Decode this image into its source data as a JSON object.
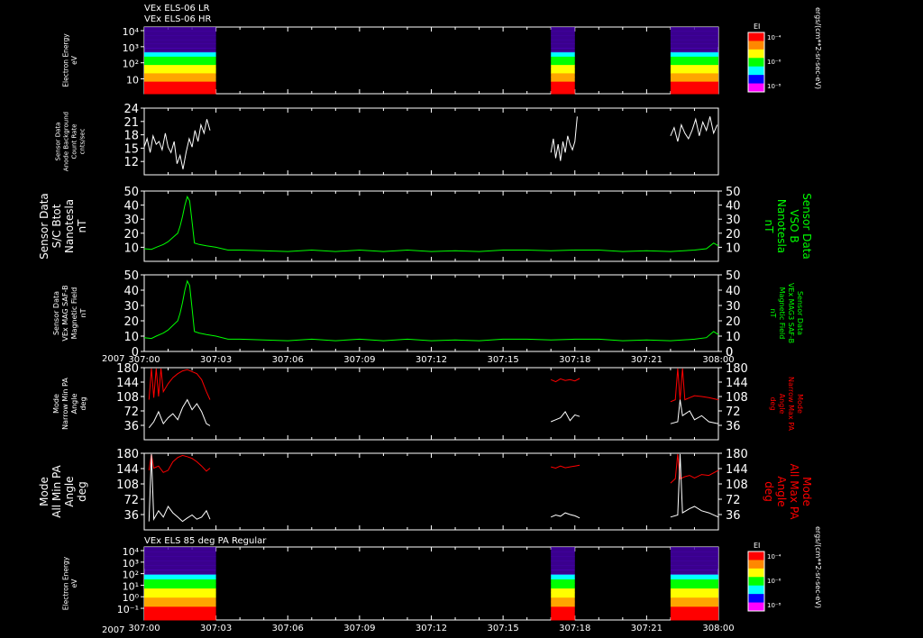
{
  "header": {
    "line1": "VEx ELS-06 LR",
    "line2": "VEx ELS-06 HR"
  },
  "panel7_title": "VEx ELS 85 deg PA Regular",
  "year": "2007",
  "x_ticks": [
    "307:00",
    "307:03",
    "307:06",
    "307:09",
    "307:12",
    "307:15",
    "307:18",
    "307:21",
    "308:00"
  ],
  "colors": {
    "white": "#ffffff",
    "green": "#00ff00",
    "red": "#ff0000",
    "frame": "#ffffff",
    "background": "#000000"
  },
  "colorbar": {
    "label": "EI",
    "units": "ergs/(cm**2-sr-sec-eV)",
    "ticks": [
      "10⁻⁴",
      "10⁻⁶",
      "10⁻⁸"
    ],
    "colors": [
      "#ff0000",
      "#ff8800",
      "#ffff00",
      "#00ff00",
      "#00ffff",
      "#0000ff",
      "#ff00ff"
    ]
  },
  "chart_data": [
    {
      "type": "heatmap",
      "ylabel": [
        "Electron Energy",
        "eV"
      ],
      "yscale": "log",
      "yticks": [
        "10⁴",
        "10³",
        "10²",
        "10"
      ],
      "data_blocks": [
        {
          "start": "307:00",
          "end": "307:03"
        },
        {
          "start": "307:17",
          "end": "307:18"
        },
        {
          "start": "307:22",
          "end": "307:24"
        }
      ]
    },
    {
      "type": "line",
      "ylabel": [
        "Sensor Data",
        "Anode Background",
        "Count Rate",
        "cnts/sec"
      ],
      "ylim": [
        12,
        24
      ],
      "yticks": [
        "24",
        "21",
        "18",
        "15",
        "12"
      ],
      "series": [
        {
          "color": "#ffffff",
          "segments": [
            {
              "x": [
                0.0,
                0.12,
                0.25,
                0.37,
                0.5,
                0.62,
                0.75,
                0.88,
                1.0,
                1.12,
                1.25,
                1.37,
                1.5,
                1.62,
                1.75,
                1.88,
                2.0,
                2.12,
                2.25,
                2.37,
                2.5,
                2.62,
                2.75
              ],
              "y": [
                17,
                18.5,
                16,
                19,
                17.5,
                18,
                16.5,
                19.5,
                17,
                16,
                18,
                14,
                15.5,
                13,
                16,
                18.5,
                17,
                20,
                18,
                21,
                19.5,
                22,
                20
              ]
            },
            {
              "x": [
                17.0,
                17.1,
                17.2,
                17.3,
                17.4,
                17.5,
                17.6,
                17.7,
                17.8,
                17.9,
                18.0,
                18.1
              ],
              "y": [
                16,
                18.5,
                15,
                17.5,
                14.5,
                18,
                16,
                19,
                17.5,
                16.5,
                18,
                22.5
              ]
            },
            {
              "x": [
                22.0,
                22.15,
                22.3,
                22.45,
                22.6,
                22.75,
                22.9,
                23.05,
                23.2,
                23.35,
                23.5,
                23.65,
                23.8,
                23.95
              ],
              "y": [
                19,
                20.5,
                18,
                21,
                19.5,
                18.5,
                20,
                22,
                19,
                21.5,
                20,
                22.5,
                19.5,
                21
              ]
            }
          ]
        }
      ]
    },
    {
      "type": "line",
      "ylabel": [
        "Sensor Data",
        "S/C Btot",
        "Nanotesla",
        "nT"
      ],
      "ylabel_right": [
        "Sensor Data",
        "VSO B",
        "Nanotesla",
        "nT"
      ],
      "ylim": [
        0,
        50
      ],
      "yticks": [
        "50",
        "40",
        "30",
        "20",
        "10"
      ],
      "series": [
        {
          "color": "#00ff00",
          "x": [
            0,
            0.3,
            0.5,
            0.8,
            1.0,
            1.2,
            1.4,
            1.5,
            1.6,
            1.7,
            1.8,
            1.9,
            2.0,
            2.1,
            2.3,
            2.6,
            3.0,
            3.5,
            4,
            5,
            6,
            7,
            8,
            9,
            10,
            11,
            12,
            13,
            14,
            15,
            16,
            17,
            18,
            19,
            20,
            21,
            22,
            23,
            23.5,
            23.8,
            24
          ],
          "y": [
            9,
            8.5,
            10,
            12,
            14,
            17,
            20,
            25,
            32,
            40,
            46,
            43,
            28,
            13,
            12,
            11,
            10,
            8,
            8,
            7.5,
            7,
            8,
            7,
            8,
            7,
            8,
            7,
            7.5,
            7,
            8,
            8,
            7.5,
            8,
            8,
            7,
            7.5,
            7,
            8,
            9,
            13,
            11
          ]
        }
      ]
    },
    {
      "type": "line",
      "ylabel": [
        "Sensor Data",
        "VEx MAG SAF-B",
        "Magnetic Field",
        "nT"
      ],
      "ylabel_right": [
        "Sensor Data",
        "VEx MAG3 SAF-B",
        "Magnetic Field",
        "nT"
      ],
      "ylim": [
        0,
        50
      ],
      "yticks": [
        "50",
        "40",
        "30",
        "20",
        "10",
        "0"
      ],
      "series": [
        {
          "color": "#00ff00",
          "x": [
            0,
            0.3,
            0.5,
            0.8,
            1.0,
            1.2,
            1.4,
            1.5,
            1.6,
            1.7,
            1.8,
            1.9,
            2.0,
            2.1,
            2.3,
            2.6,
            3.0,
            3.5,
            4,
            5,
            6,
            7,
            8,
            9,
            10,
            11,
            12,
            13,
            14,
            15,
            16,
            17,
            18,
            19,
            20,
            21,
            22,
            23,
            23.5,
            23.8,
            24
          ],
          "y": [
            9,
            8.5,
            10,
            12,
            14,
            17,
            20,
            25,
            32,
            40,
            46,
            43,
            28,
            13,
            12,
            11,
            10,
            8,
            8,
            7.5,
            7,
            8,
            7,
            8,
            7,
            8,
            7,
            7.5,
            7,
            8,
            8,
            7.5,
            8,
            8,
            7,
            7.5,
            7,
            8,
            9,
            13,
            11
          ]
        }
      ]
    },
    {
      "type": "line",
      "ylabel": [
        "Mode",
        "Narrow Min PA",
        "Angle",
        "deg"
      ],
      "ylabel_right": [
        "Mode",
        "Narrow Max PA",
        "Angle",
        "deg"
      ],
      "ylim": [
        0,
        180
      ],
      "yticks": [
        "180",
        "144",
        "108",
        "72",
        "36"
      ],
      "series": [
        {
          "color": "#ff0000",
          "segments": [
            {
              "x": [
                0.2,
                0.3,
                0.4,
                0.5,
                0.6,
                0.7,
                0.8,
                1.0,
                1.2,
                1.4,
                1.6,
                1.8,
                2.0,
                2.2,
                2.4,
                2.6,
                2.75
              ],
              "y": [
                100,
                178,
                105,
                178,
                108,
                178,
                120,
                140,
                155,
                165,
                172,
                175,
                170,
                165,
                150,
                120,
                100
              ]
            },
            {
              "x": [
                17.0,
                17.2,
                17.4,
                17.6,
                17.8,
                18.0,
                18.2
              ],
              "y": [
                150,
                145,
                152,
                148,
                150,
                147,
                153
              ]
            },
            {
              "x": [
                22.0,
                22.2,
                22.3,
                22.4,
                22.5,
                22.6,
                22.8,
                23.0,
                23.3,
                23.6,
                24.0
              ],
              "y": [
                95,
                100,
                178,
                100,
                178,
                100,
                105,
                110,
                108,
                105,
                100
              ]
            }
          ]
        },
        {
          "color": "#ffffff",
          "segments": [
            {
              "x": [
                0.2,
                0.4,
                0.6,
                0.8,
                1.0,
                1.2,
                1.4,
                1.6,
                1.8,
                2.0,
                2.2,
                2.4,
                2.6,
                2.75
              ],
              "y": [
                30,
                45,
                70,
                40,
                55,
                65,
                50,
                80,
                100,
                75,
                90,
                70,
                40,
                35
              ]
            },
            {
              "x": [
                17.0,
                17.2,
                17.4,
                17.6,
                17.8,
                18.0,
                18.2
              ],
              "y": [
                45,
                50,
                55,
                70,
                48,
                62,
                58
              ]
            },
            {
              "x": [
                22.0,
                22.3,
                22.4,
                22.5,
                22.8,
                23.0,
                23.3,
                23.6,
                24.0
              ],
              "y": [
                40,
                45,
                100,
                60,
                72,
                50,
                60,
                45,
                40
              ]
            }
          ]
        }
      ]
    },
    {
      "type": "line",
      "ylabel": [
        "Mode",
        "All Min PA",
        "Angle",
        "deg"
      ],
      "ylabel_right": [
        "Mode",
        "All Max PA",
        "Angle",
        "deg"
      ],
      "ylim": [
        0,
        180
      ],
      "yticks": [
        "180",
        "144",
        "108",
        "72",
        "36"
      ],
      "series": [
        {
          "color": "#ff0000",
          "segments": [
            {
              "x": [
                0.2,
                0.3,
                0.4,
                0.6,
                0.8,
                1.0,
                1.2,
                1.4,
                1.6,
                1.8,
                2.0,
                2.2,
                2.4,
                2.6,
                2.75
              ],
              "y": [
                140,
                178,
                145,
                150,
                135,
                140,
                160,
                170,
                175,
                172,
                168,
                160,
                150,
                138,
                145
              ]
            },
            {
              "x": [
                17.0,
                17.2,
                17.4,
                17.6,
                17.8,
                18.0,
                18.2
              ],
              "y": [
                148,
                145,
                150,
                146,
                148,
                150,
                152
              ]
            },
            {
              "x": [
                22.0,
                22.2,
                22.3,
                22.4,
                22.6,
                22.8,
                23.0,
                23.3,
                23.6,
                24.0
              ],
              "y": [
                110,
                120,
                178,
                120,
                125,
                128,
                122,
                130,
                128,
                140
              ]
            }
          ]
        },
        {
          "color": "#ffffff",
          "segments": [
            {
              "x": [
                0.2,
                0.3,
                0.4,
                0.6,
                0.8,
                1.0,
                1.2,
                1.4,
                1.6,
                1.8,
                2.0,
                2.2,
                2.4,
                2.6,
                2.75
              ],
              "y": [
                20,
                178,
                25,
                45,
                30,
                55,
                40,
                30,
                20,
                28,
                35,
                25,
                30,
                45,
                25
              ]
            },
            {
              "x": [
                17.0,
                17.2,
                17.4,
                17.6,
                17.8,
                18.0,
                18.2
              ],
              "y": [
                30,
                35,
                32,
                40,
                36,
                33,
                28
              ]
            },
            {
              "x": [
                22.0,
                22.3,
                22.4,
                22.5,
                22.8,
                23.0,
                23.3,
                23.6,
                24.0
              ],
              "y": [
                30,
                35,
                178,
                40,
                50,
                55,
                45,
                40,
                30
              ]
            }
          ]
        }
      ]
    },
    {
      "type": "heatmap",
      "ylabel": [
        "Electron Energy",
        "eV"
      ],
      "yscale": "log",
      "yticks": [
        "10⁴",
        "10³",
        "10²",
        "10¹",
        "10⁰",
        "10⁻¹"
      ],
      "data_blocks": [
        {
          "start": "307:00",
          "end": "307:03"
        },
        {
          "start": "307:17",
          "end": "307:18"
        },
        {
          "start": "307:22",
          "end": "307:24"
        }
      ]
    }
  ]
}
